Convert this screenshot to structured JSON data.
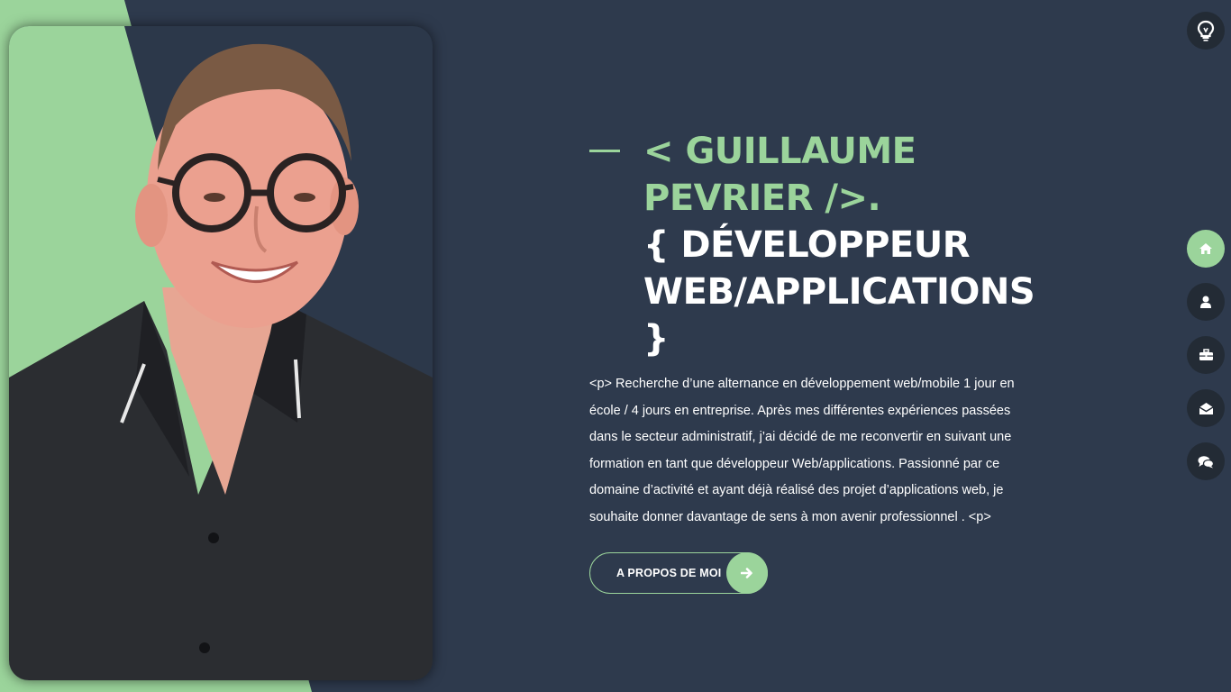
{
  "colors": {
    "background": "#2e3a4d",
    "accent": "#9bd49b",
    "icon_button": "#232b35",
    "text": "#ffffff"
  },
  "hero": {
    "name_line": "< GUILLAUME PEVRIER />.",
    "role_line": "{ DÉVELOPPEUR WEB/APPLICATIONS }",
    "intro": "<p> Recherche d’une alternance en développement web/mobile 1 jour en école / 4 jours en entreprise. Après mes différentes expériences passées dans le secteur administratif, j’ai décidé de me reconvertir en suivant une formation en tant que développeur Web/applications. Passionné par ce domaine d’activité et ayant déjà réalisé des projet d’applications web, je souhaite donner davantage de sens à mon avenir professionnel . <p>",
    "cta_label": "A PROPOS DE MOI",
    "cta_icon": "arrow-right-icon"
  },
  "theme_toggle": {
    "icon": "lightbulb-icon"
  },
  "nav": [
    {
      "icon": "home-icon",
      "active": true
    },
    {
      "icon": "user-icon",
      "active": false
    },
    {
      "icon": "briefcase-icon",
      "active": false
    },
    {
      "icon": "envelope-open-icon",
      "active": false
    },
    {
      "icon": "comments-icon",
      "active": false
    }
  ],
  "portrait": {
    "icon": "profile-photo"
  }
}
